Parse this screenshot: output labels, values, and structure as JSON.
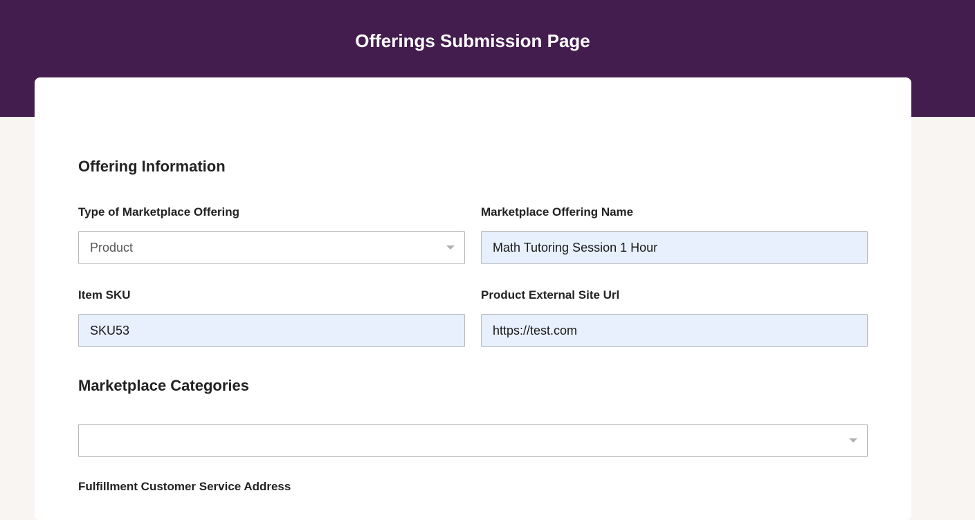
{
  "header": {
    "title": "Offerings Submission Page",
    "background_color": "#441d4f"
  },
  "sections": {
    "offering_information": {
      "title": "Offering Information",
      "type_of_offering": {
        "label": "Type of Marketplace Offering",
        "value": "Product"
      },
      "offering_name": {
        "label": "Marketplace Offering Name",
        "value": "Math Tutoring Session 1 Hour"
      },
      "item_sku": {
        "label": "Item SKU",
        "value": "SKU53"
      },
      "external_url": {
        "label": "Product External Site Url",
        "value": "https://test.com"
      }
    },
    "marketplace_categories": {
      "title": "Marketplace Categories",
      "categories_select": {
        "value": ""
      },
      "next_label": "Fulfillment Customer Service Address"
    }
  },
  "icons": {
    "dropdown": "chevron-down-icon"
  }
}
